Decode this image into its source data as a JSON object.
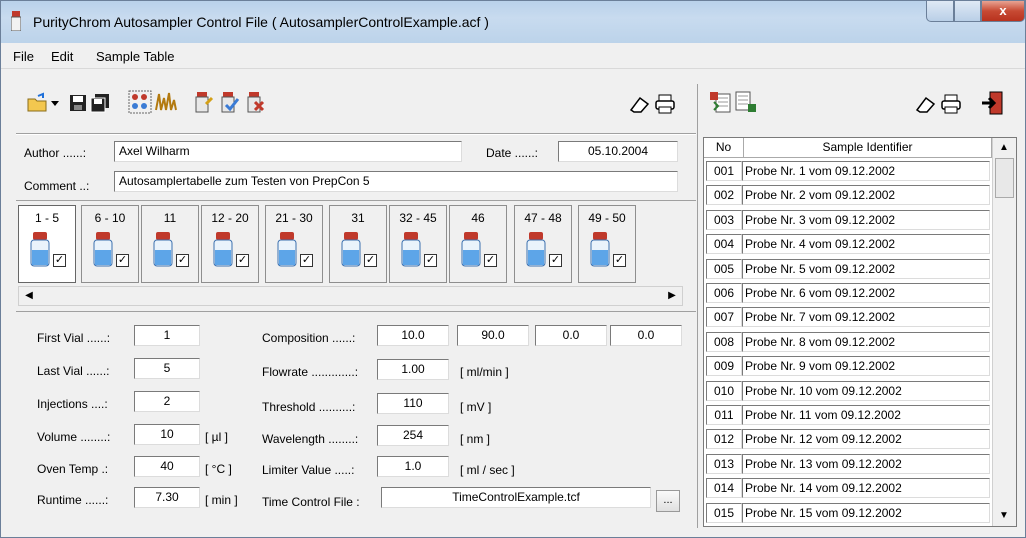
{
  "window": {
    "title": "PurityChrom Autosampler Control File ( AutosamplerControlExample.acf )",
    "close_glyph": "x"
  },
  "menu": [
    "File",
    "Edit",
    "Sample Table"
  ],
  "header": {
    "author_label": "Author ......:",
    "author_value": "Axel Wilharm",
    "date_label": "Date ......:",
    "date_value": "05.10.2004",
    "comment_label": "Comment ..:",
    "comment_value": "Autosamplertabelle zum Testen von PrepCon 5"
  },
  "vial_tabs": [
    "1 - 5",
    "6 - 10",
    "11",
    "12 - 20",
    "21 - 30",
    "31",
    "32 - 45",
    "46",
    "47 - 48",
    "49 - 50"
  ],
  "checkmark": "✓",
  "params_left": [
    {
      "label": "First Vial ......:",
      "value": "1",
      "unit": ""
    },
    {
      "label": "Last Vial ......:",
      "value": "5",
      "unit": ""
    },
    {
      "label": "Injections ....:",
      "value": "2",
      "unit": ""
    },
    {
      "label": "Volume ........:",
      "value": "10",
      "unit": "[ µl ]"
    },
    {
      "label": "Oven Temp .:",
      "value": "40",
      "unit": "[ °C ]"
    },
    {
      "label": "Runtime ......:",
      "value": "7.30",
      "unit": "[ min ]"
    }
  ],
  "params_right": {
    "composition_label": "Composition ......:",
    "composition_values": [
      "10.0",
      "90.0",
      "0.0",
      "0.0"
    ],
    "flowrate_label": "Flowrate .............:",
    "flowrate_value": "1.00",
    "flowrate_unit": "[ ml/min ]",
    "threshold_label": "Threshold ..........:",
    "threshold_value": "110",
    "threshold_unit": "[ mV ]",
    "wavelength_label": "Wavelength ........:",
    "wavelength_value": "254",
    "wavelength_unit": "[ nm ]",
    "limiter_label": "Limiter Value .....:",
    "limiter_value": "1.0",
    "limiter_unit": "[ ml / sec ]",
    "tcf_label": "Time Control File :",
    "tcf_value": "TimeControlExample.tcf",
    "browse_label": "..."
  },
  "sample_table": {
    "col_no": "No",
    "col_id": "Sample Identifier",
    "rows": [
      {
        "no": "001",
        "id": "Probe Nr. 1 vom 09.12.2002"
      },
      {
        "no": "002",
        "id": "Probe Nr. 2 vom 09.12.2002"
      },
      {
        "no": "003",
        "id": "Probe Nr. 3 vom 09.12.2002"
      },
      {
        "no": "004",
        "id": "Probe Nr. 4 vom 09.12.2002"
      },
      {
        "no": "005",
        "id": "Probe Nr. 5 vom 09.12.2002"
      },
      {
        "no": "006",
        "id": "Probe Nr. 6 vom 09.12.2002"
      },
      {
        "no": "007",
        "id": "Probe Nr. 7 vom 09.12.2002"
      },
      {
        "no": "008",
        "id": "Probe Nr. 8 vom 09.12.2002"
      },
      {
        "no": "009",
        "id": "Probe Nr. 9 vom 09.12.2002"
      },
      {
        "no": "010",
        "id": "Probe Nr. 10 vom 09.12.2002"
      },
      {
        "no": "011",
        "id": "Probe Nr. 11 vom 09.12.2002"
      },
      {
        "no": "012",
        "id": "Probe Nr. 12 vom 09.12.2002"
      },
      {
        "no": "013",
        "id": "Probe Nr. 13 vom 09.12.2002"
      },
      {
        "no": "014",
        "id": "Probe Nr. 14 vom 09.12.2002"
      },
      {
        "no": "015",
        "id": "Probe Nr. 15 vom 09.12.2002"
      }
    ]
  },
  "colors": {
    "accent": "#3a7bd5",
    "close": "#c74a33"
  }
}
